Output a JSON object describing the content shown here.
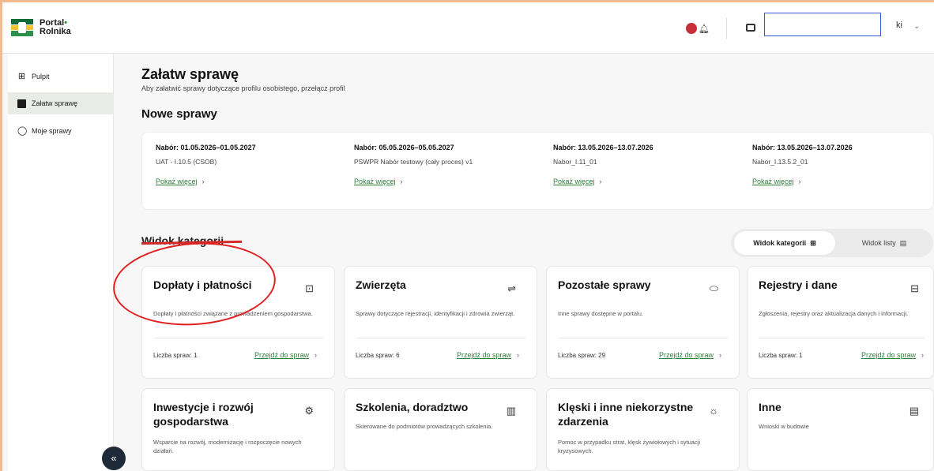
{
  "header": {
    "logo_line1": "Portal",
    "logo_dot": "•",
    "logo_line2": "Rolnika",
    "notification_count": "",
    "user_suffix": "ki"
  },
  "sidebar": {
    "items": [
      {
        "label": "Pulpit",
        "icon": "grid-icon",
        "active": false
      },
      {
        "label": "Załatw sprawę",
        "icon": "document-icon",
        "active": true
      },
      {
        "label": "Moje sprawy",
        "icon": "chat-icon",
        "active": false
      }
    ],
    "collapse_label": "«"
  },
  "main": {
    "title": "Załatw sprawę",
    "subtitle": "Aby załatwić sprawy dotyczące profilu osobistego, przełącz profil",
    "new_cases_title": "Nowe sprawy",
    "new_cases": [
      {
        "date": "Nabór: 01.05.2026–01.05.2027",
        "name": "UAT - I.10.5 (CSOB)",
        "link": "Pokaż więcej"
      },
      {
        "date": "Nabór: 05.05.2026–05.05.2027",
        "name": "PSWPR Nabór testowy (cały proces) v1",
        "link": "Pokaż więcej"
      },
      {
        "date": "Nabór: 13.05.2026–13.07.2026",
        "name": "Nabor_I.11_01",
        "link": "Pokaż więcej"
      },
      {
        "date": "Nabór: 13.05.2026–13.07.2026",
        "name": "Nabor_I.13.5.2_01",
        "link": "Pokaż więcej"
      }
    ],
    "categories_title": "Widok kategorii",
    "view_toggle": {
      "category": "Widok kategorii",
      "list": "Widok listy"
    },
    "categories": [
      {
        "title": "Dopłaty i płatności",
        "desc": "Dopłaty i płatności związane z prowadzeniem gospodarstwa.",
        "count": "Liczba spraw: 1",
        "link": "Przejdź do spraw",
        "icon": "money-icon"
      },
      {
        "title": "Zwierzęta",
        "desc": "Sprawy dotyczące rejestracji, identyfikacji i zdrowia zwierząt.",
        "count": "Liczba spraw: 6",
        "link": "Przejdź do spraw",
        "icon": "cow-icon"
      },
      {
        "title": "Pozostałe sprawy",
        "desc": "Inne sprawy dostępne w portalu.",
        "count": "Liczba spraw: 29",
        "link": "Przejdź do spraw",
        "icon": "folder-icon"
      },
      {
        "title": "Rejestry i dane",
        "desc": "Zgłoszenia, rejestry oraz aktualizacja danych i informacji.",
        "count": "Liczba spraw: 1",
        "link": "Przejdź do spraw",
        "icon": "register-icon"
      },
      {
        "title": "Inwestycje i rozwój gospodarstwa",
        "desc": "Wsparcie na rozwój, modernizację i rozpoczęcie nowych działań.",
        "icon": "tractor-icon"
      },
      {
        "title": "Szkolenia, doradztwo",
        "desc": "Skierowane do podmiotów prowadzących szkolenia.",
        "icon": "book-icon"
      },
      {
        "title": "Klęski i inne niekorzystne zdarzenia",
        "desc": "Pomoc w przypadku strat, klęsk żywiołowych i sytuacji kryzysowych.",
        "icon": "storm-icon"
      },
      {
        "title": "Inne",
        "desc": "Wnioski w budowie",
        "icon": "list-icon"
      }
    ]
  }
}
